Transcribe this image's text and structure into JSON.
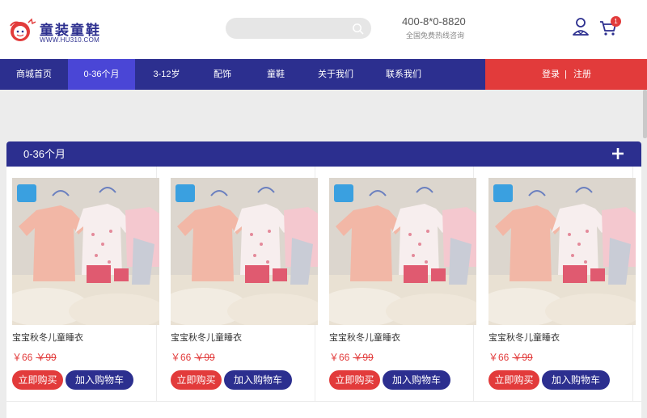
{
  "brand": {
    "title": "童装童鞋",
    "url": "WWW.HU310.COM",
    "logo_icon": "baby-face-logo",
    "colors": {
      "primary": "#2c2f8f",
      "accent": "#e23b3b",
      "active_nav": "#4a46d6"
    }
  },
  "search": {
    "placeholder": "",
    "icon": "search-icon"
  },
  "hotline": {
    "number": "400-8*0-8820",
    "label": "全国免费热线咨询"
  },
  "cart": {
    "count": "1",
    "icon": "cart-icon"
  },
  "user": {
    "icon": "user-icon"
  },
  "nav": {
    "items": [
      {
        "label": "商城首页"
      },
      {
        "label": "0-36个月",
        "active": true
      },
      {
        "label": "3-12岁"
      },
      {
        "label": "配饰"
      },
      {
        "label": "童鞋"
      },
      {
        "label": "关于我们"
      },
      {
        "label": "联系我们"
      }
    ],
    "login": "登录",
    "separator": "|",
    "register": "注册"
  },
  "section": {
    "title": "0-36个月",
    "expand_icon": "plus-icon"
  },
  "products": [
    {
      "name": "宝宝秋冬儿童睡衣",
      "price": "￥66",
      "old_price": "￥99",
      "buy_label": "立即购买",
      "cart_label": "加入购物车"
    },
    {
      "name": "宝宝秋冬儿童睡衣",
      "price": "￥66",
      "old_price": "￥99",
      "buy_label": "立即购买",
      "cart_label": "加入购物车"
    },
    {
      "name": "宝宝秋冬儿童睡衣",
      "price": "￥66",
      "old_price": "￥99",
      "buy_label": "立即购买",
      "cart_label": "加入购物车"
    },
    {
      "name": "宝宝秋冬儿童睡衣",
      "price": "￥66",
      "old_price": "￥99",
      "buy_label": "立即购买",
      "cart_label": "加入购物车"
    }
  ]
}
